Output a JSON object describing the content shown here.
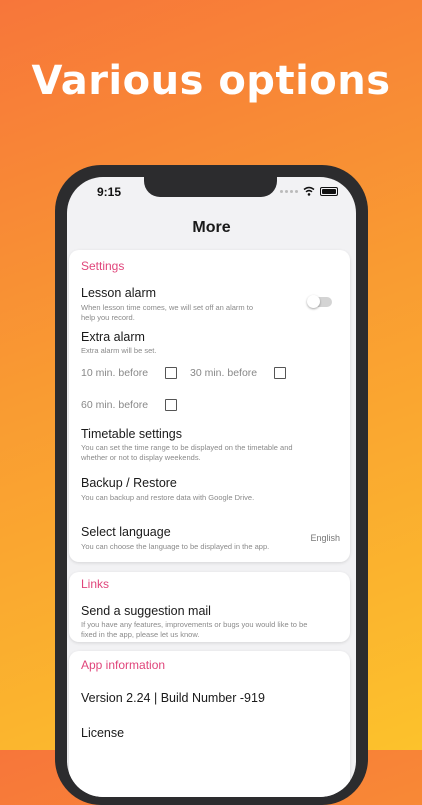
{
  "headline": "Various options",
  "status_bar": {
    "time": "9:15"
  },
  "nav": {
    "title": "More"
  },
  "settings": {
    "section_title": "Settings",
    "lesson_alarm": {
      "title": "Lesson alarm",
      "desc_1": "When lesson time comes, we will set off an alarm to",
      "desc_2": "help you record.",
      "enabled": false
    },
    "extra_alarm": {
      "title": "Extra alarm",
      "desc": "Extra alarm will be set.",
      "options": [
        {
          "label": "10 min. before",
          "checked": false
        },
        {
          "label": "30 min. before",
          "checked": false
        },
        {
          "label": "60 min. before",
          "checked": false
        }
      ]
    },
    "timetable": {
      "title": "Timetable settings",
      "desc_1": "You can set the time range to be displayed on the timetable and",
      "desc_2": "whether or not to display weekends."
    },
    "backup": {
      "title": "Backup / Restore",
      "desc": "You can backup and restore data with Google Drive."
    },
    "language": {
      "title": "Select language",
      "desc": "You can choose the language to be displayed in the app.",
      "value": "English"
    }
  },
  "links": {
    "section_title": "Links",
    "suggestion": {
      "title": "Send a suggestion mail",
      "desc_1": "If you have any features, improvements or bugs you would like to be",
      "desc_2": "fixed in the app, please let us know."
    }
  },
  "app_info": {
    "section_title": "App information",
    "version": "Version 2.24 | Build Number -919",
    "license": "License"
  },
  "colors": {
    "accent": "#e0457b",
    "bg_gradient_start": "#f7763a",
    "bg_gradient_end": "#fcc22c"
  }
}
